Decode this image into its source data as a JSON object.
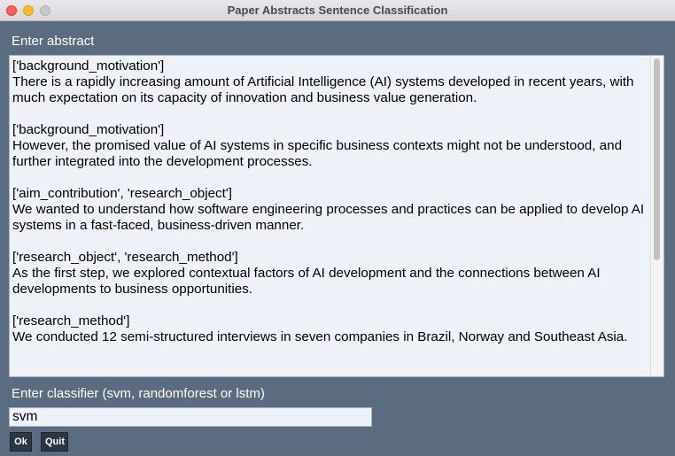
{
  "window": {
    "title": "Paper Abstracts Sentence Classification"
  },
  "abstract": {
    "label": "Enter abstract",
    "entries": [
      {
        "tags": "['background_motivation']",
        "sentence": " There is a rapidly increasing amount of Artificial Intelligence (AI) systems developed in recent years, with much expectation on its capacity of innovation and business value generation."
      },
      {
        "tags": "['background_motivation']",
        "sentence": " However, the promised value of AI systems in specific business contexts might not be understood, and further integrated into the development processes."
      },
      {
        "tags": "['aim_contribution', 'research_object']",
        "sentence": " We wanted to understand how software engineering processes and practices can be applied to develop AI systems in a fast-faced, business-driven manner."
      },
      {
        "tags": "['research_object', 'research_method']",
        "sentence": " As the first step, we explored contextual factors of AI development and the connections between AI developments to business opportunities."
      },
      {
        "tags": "['research_method']",
        "sentence": " We conducted 12 semi-structured interviews in seven companies in Brazil, Norway and Southeast Asia."
      }
    ]
  },
  "classifier": {
    "label": "Enter classifier (svm, randomforest or lstm)",
    "value": "svm"
  },
  "buttons": {
    "ok": "Ok",
    "quit": "Quit"
  },
  "colors": {
    "window_background": "#5b6b80",
    "field_background": "#eef1f7",
    "button_background": "#2b3646",
    "close_button": "#fe5f57",
    "minimize_button": "#febc2e"
  }
}
